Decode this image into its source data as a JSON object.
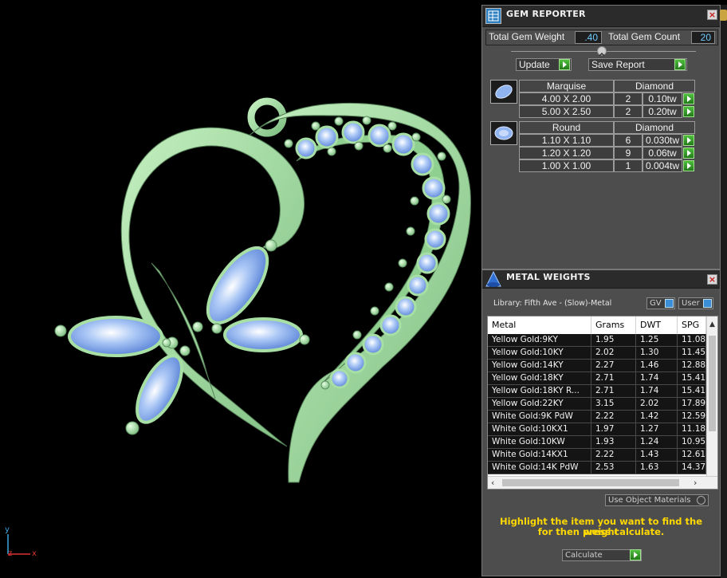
{
  "gem_reporter": {
    "title": "GEM REPORTER",
    "total_weight_label": "Total Gem Weight",
    "total_weight_value": ".40",
    "total_count_label": "Total Gem Count",
    "total_count_value": "20",
    "update_label": "Update",
    "save_report_label": "Save Report",
    "groups": [
      {
        "shape": "Marquise",
        "material": "Diamond",
        "rows": [
          {
            "size": "4.00 X 2.00",
            "count": "2",
            "weight": "0.10tw"
          },
          {
            "size": "5.00 X 2.50",
            "count": "2",
            "weight": "0.20tw"
          }
        ]
      },
      {
        "shape": "Round",
        "material": "Diamond",
        "rows": [
          {
            "size": "1.10 X 1.10",
            "count": "6",
            "weight": "0.030tw"
          },
          {
            "size": "1.20 X 1.20",
            "count": "9",
            "weight": "0.06tw"
          },
          {
            "size": "1.00 X 1.00",
            "count": "1",
            "weight": "0.004tw"
          }
        ]
      }
    ]
  },
  "metal_weights": {
    "title": "METAL WEIGHTS",
    "library_label": "Library: Fifth Ave - (Slow)-Metal",
    "gv_label": "GV",
    "user_label": "User",
    "columns": [
      "Metal",
      "Grams",
      "DWT",
      "SPG"
    ],
    "rows": [
      [
        "Yellow Gold:9KY",
        "1.95",
        "1.25",
        "11.08"
      ],
      [
        "Yellow Gold:10KY",
        "2.02",
        "1.30",
        "11.45"
      ],
      [
        "Yellow Gold:14KY",
        "2.27",
        "1.46",
        "12.88"
      ],
      [
        "Yellow Gold:18KY",
        "2.71",
        "1.74",
        "15.41"
      ],
      [
        "Yellow Gold:18KY R...",
        "2.71",
        "1.74",
        "15.41"
      ],
      [
        "Yellow Gold:22KY",
        "3.15",
        "2.02",
        "17.89"
      ],
      [
        "White Gold:9K PdW",
        "2.22",
        "1.42",
        "12.59"
      ],
      [
        "White Gold:10KX1",
        "1.97",
        "1.27",
        "11.18"
      ],
      [
        "White Gold:10KW",
        "1.93",
        "1.24",
        "10.95"
      ],
      [
        "White Gold:14KX1",
        "2.22",
        "1.43",
        "12.61"
      ],
      [
        "White Gold:14K PdW",
        "2.53",
        "1.63",
        "14.37"
      ]
    ],
    "use_object_materials_label": "Use Object Materials",
    "instruction": [
      "Highlight the item you want to find the weight",
      "for then press calculate."
    ],
    "calculate_label": "Calculate"
  },
  "axis": {
    "y": "y",
    "z": "z",
    "x": "x"
  },
  "colors": {
    "metal": "#a7dfa5",
    "metal_dark": "#6fae74",
    "gem": "#7ea8ea",
    "instruction_text": "#ffd800"
  }
}
